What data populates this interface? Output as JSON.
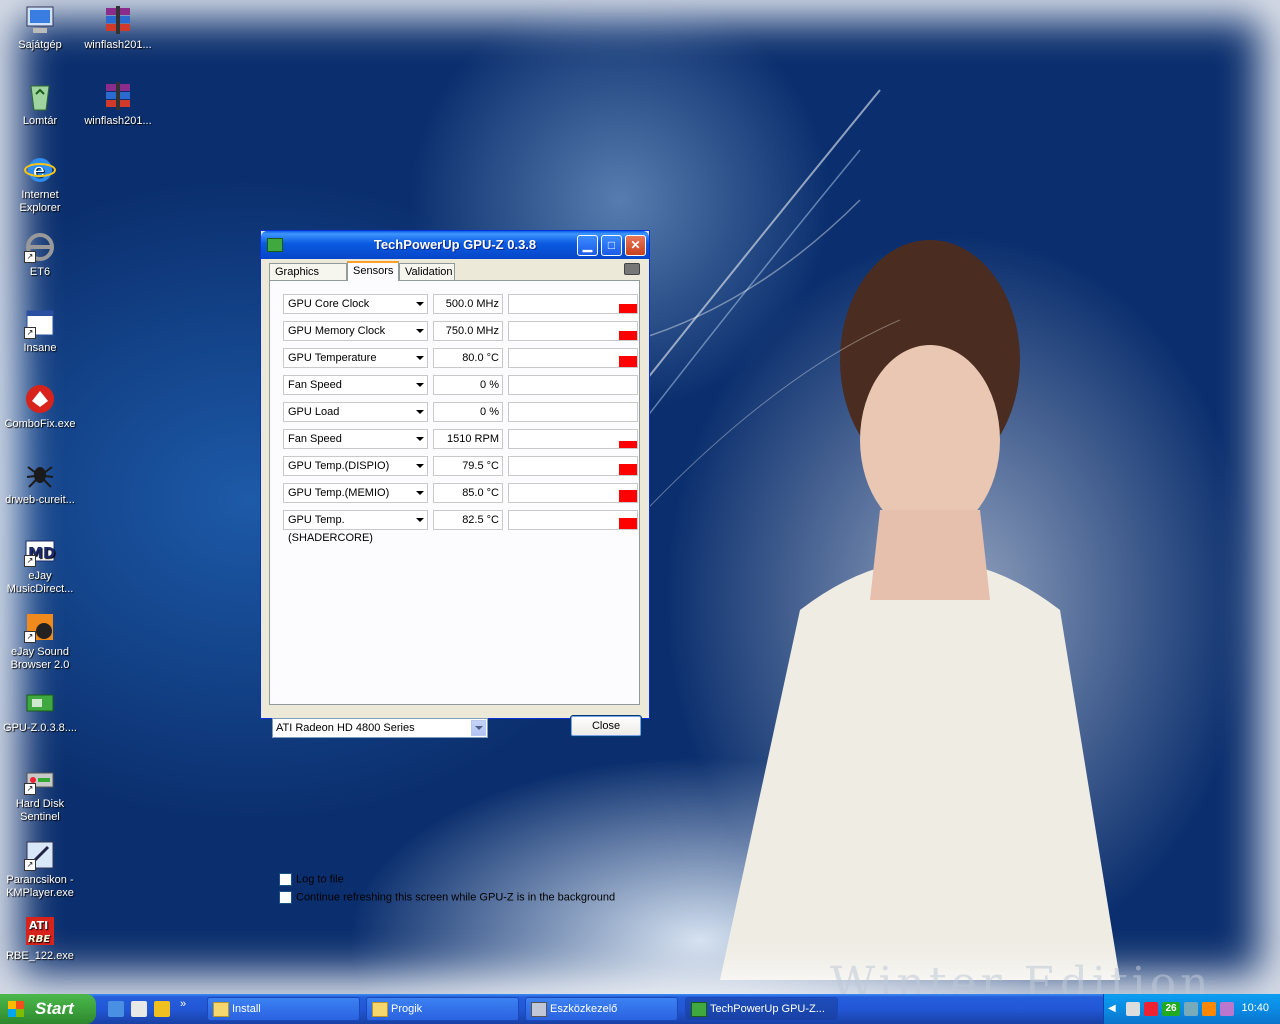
{
  "desktop": {
    "watermark": "Winter Edition",
    "icons": [
      {
        "label": "Sajátgép"
      },
      {
        "label": "winflash201..."
      },
      {
        "label": "Lomtár"
      },
      {
        "label": "winflash201..."
      },
      {
        "label": "Internet Explorer"
      },
      {
        "label": "ET6"
      },
      {
        "label": "Insane"
      },
      {
        "label": "ComboFix.exe"
      },
      {
        "label": "drweb-cureit..."
      },
      {
        "label": "eJay MusicDirect..."
      },
      {
        "label": "eJay Sound Browser 2.0"
      },
      {
        "label": "GPU-Z.0.3.8...."
      },
      {
        "label": "Hard Disk Sentinel"
      },
      {
        "label": "Parancsikon - KMPlayer.exe"
      },
      {
        "label": "RBE_122.exe"
      }
    ]
  },
  "window": {
    "title": "TechPowerUp GPU-Z 0.3.8",
    "tabs": [
      "Graphics Card",
      "Sensors",
      "Validation"
    ],
    "active_tab": "Sensors",
    "sensors": [
      {
        "name": "GPU Core Clock",
        "value": "500.0 MHz",
        "level": 0.5
      },
      {
        "name": "GPU Memory Clock",
        "value": "750.0 MHz",
        "level": 0.5
      },
      {
        "name": "GPU Temperature",
        "value": "80.0 °C",
        "level": 0.6
      },
      {
        "name": "Fan Speed",
        "value": "0 %",
        "level": 0
      },
      {
        "name": "GPU Load",
        "value": "0 %",
        "level": 0
      },
      {
        "name": "Fan Speed",
        "value": "1510 RPM",
        "level": 0.4
      },
      {
        "name": "GPU Temp.(DISPIO)",
        "value": "79.5 °C",
        "level": 0.6
      },
      {
        "name": "GPU Temp.(MEMIO)",
        "value": "85.0 °C",
        "level": 0.65
      },
      {
        "name": "GPU Temp.(SHADERCORE)",
        "value": "82.5 °C",
        "level": 0.62
      }
    ],
    "log_to_file": "Log to file",
    "continue_refresh": "Continue refreshing this screen while GPU-Z is in the background",
    "gpu_select": "ATI Radeon HD 4800 Series",
    "close_label": "Close"
  },
  "taskbar": {
    "start_label": "Start",
    "items": [
      "Install",
      "Progik",
      "Eszközkezelő",
      "TechPowerUp GPU-Z..."
    ],
    "tray_badge": "26",
    "clock": "10:40"
  },
  "colors": {
    "accent": "#0a5ae0",
    "graph_bar": "#ff0000",
    "start_green": "#3a9d3a"
  }
}
